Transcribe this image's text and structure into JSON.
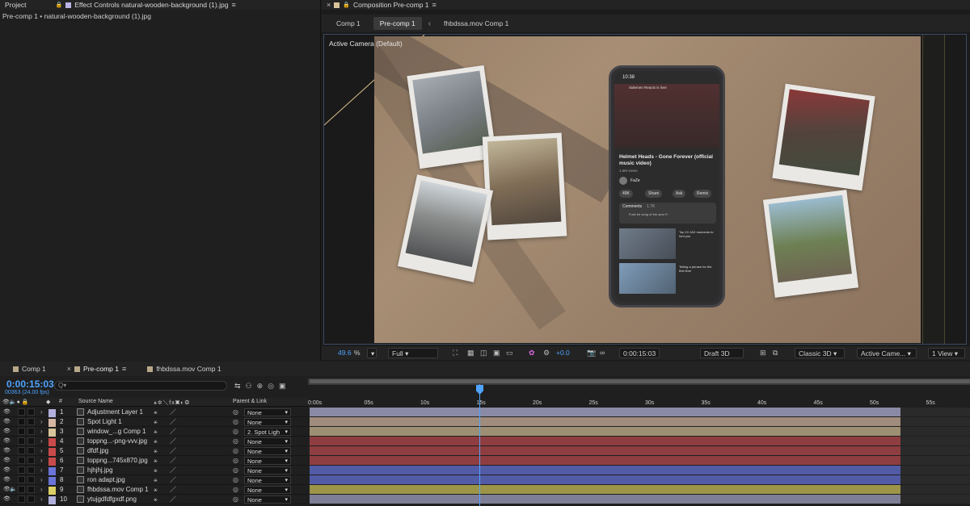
{
  "left_panel": {
    "tabs": [
      {
        "label": "Project",
        "color": "#cfcfcf"
      },
      {
        "label": "Effect Controls natural-wooden-background (1).jpg",
        "color": "#b9b6e6"
      }
    ],
    "subtitle": "Pre-comp 1 • natural-wooden-background (1).jpg"
  },
  "composition_panel": {
    "tab_label": "Composition Pre-comp 1",
    "flow": [
      "Comp 1",
      "Pre-comp 1",
      "fhbdssa.mov Comp 1"
    ],
    "active_camera": "Active Camera (Default)",
    "phone": {
      "time": "10:38",
      "notification": "Sidemen Reacts is live!",
      "video_title": "Helmet Heads - Gone Forever (official music video)",
      "channel": "FaZe",
      "meta": "1.6M views",
      "likes": "49K",
      "share": "Share",
      "ask": "Ask",
      "remix": "Remix",
      "comments_label": "Comments",
      "comments_count": "1.7K",
      "comment_text": "Fuck be song of the year !!!",
      "rec1": "Top 10 JAX moments to lord you",
      "rec2": "Telling a phrase for the first time"
    },
    "toolbar": {
      "zoom": "49.6",
      "zoom_unit": "%",
      "resolution": "Full",
      "exposure": "+0.0",
      "timecode": "0:00:15:03",
      "draft3d": "Draft 3D",
      "renderer": "Classic 3D",
      "camera": "Active Came...",
      "views": "1 View"
    }
  },
  "timeline": {
    "tabs": [
      {
        "label": "Comp 1",
        "color": "#b8a88a"
      },
      {
        "label": "Pre-comp 1",
        "color": "#b8a88a"
      },
      {
        "label": "fhbdssa.mov Comp 1",
        "color": "#b8a88a"
      }
    ],
    "current_time": "0:00:15:03",
    "frames": "00363 (24.00 fps)",
    "search_placeholder": "Q▾",
    "headers": {
      "num": "#",
      "source": "Source Name",
      "parent": "Parent & Link"
    },
    "ruler_labels": [
      "0:00s",
      "05s",
      "10s",
      "15s",
      "20s",
      "25s",
      "30s",
      "35s",
      "40s",
      "45s",
      "50s",
      "55s"
    ],
    "layers": [
      {
        "num": "1",
        "name": "Adjustment Layer 1",
        "color": "#b2b0dc",
        "parent": "None",
        "bar_color": "#8a8aa6"
      },
      {
        "num": "2",
        "name": "Spot Light 1",
        "color": "#d5b7a4",
        "parent": "None",
        "bar_color": "#a08c7c"
      },
      {
        "num": "3",
        "name": "window_...g Comp 1",
        "color": "#d8c49a",
        "parent": "2. Spot Ligh",
        "bar_color": "#9d8f73"
      },
      {
        "num": "4",
        "name": "toppng...-png-vvv.jpg",
        "color": "#c94a4a",
        "parent": "None",
        "bar_color": "#8e3d40"
      },
      {
        "num": "5",
        "name": "dfdf.jpg",
        "color": "#c94a4a",
        "parent": "None",
        "bar_color": "#8e3d40"
      },
      {
        "num": "6",
        "name": "toppng...745x870.jpg",
        "color": "#c94a4a",
        "parent": "None",
        "bar_color": "#8e3d40"
      },
      {
        "num": "7",
        "name": "hjhjhj.jpg",
        "color": "#6b74d8",
        "parent": "None",
        "bar_color": "#525ba5"
      },
      {
        "num": "8",
        "name": "ron adapt.jpg",
        "color": "#6b74d8",
        "parent": "None",
        "bar_color": "#525ba5"
      },
      {
        "num": "9",
        "name": "fhbdssa.mov Comp 1",
        "color": "#dcd066",
        "parent": "None",
        "bar_color": "#9c9448"
      },
      {
        "num": "10",
        "name": "ytujgdfdfgxdf.png",
        "color": "#b2b0dc",
        "parent": "None",
        "bar_color": "#7f7e97"
      }
    ]
  }
}
